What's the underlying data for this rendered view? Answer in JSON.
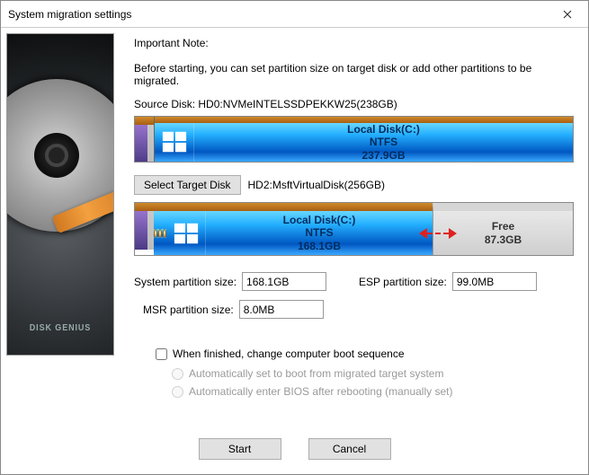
{
  "window": {
    "title": "System migration settings"
  },
  "sidebar": {
    "brand": "DISK GENIUS"
  },
  "notes": {
    "heading": "Important Note:",
    "desc": "Before starting, you can set partition size on target disk or add other partitions to be migrated.",
    "source_prefix": "Source Disk:  ",
    "source_disk": "HD0:NVMeINTELSSDPEKKW25(238GB)"
  },
  "source_partition": {
    "name": "Local Disk(C:)",
    "fs": "NTFS",
    "size": "237.9GB"
  },
  "target": {
    "select_button": "Select Target Disk",
    "disk": "HD2:MsftVirtualDisk(256GB)",
    "partition": {
      "name": "Local Disk(C:)",
      "fs": "NTFS",
      "size": "168.1GB"
    },
    "free": {
      "label": "Free",
      "size": "87.3GB"
    }
  },
  "fields": {
    "system_label": "System partition size:",
    "system_value": "168.1GB",
    "esp_label": "ESP partition size:",
    "esp_value": "99.0MB",
    "msr_label": "MSR partition size:",
    "msr_value": "8.0MB"
  },
  "boot": {
    "checkbox": "When finished, change computer boot sequence",
    "radio1": "Automatically set to boot from migrated target system",
    "radio2": "Automatically enter BIOS after rebooting (manually set)"
  },
  "footer": {
    "start": "Start",
    "cancel": "Cancel"
  }
}
